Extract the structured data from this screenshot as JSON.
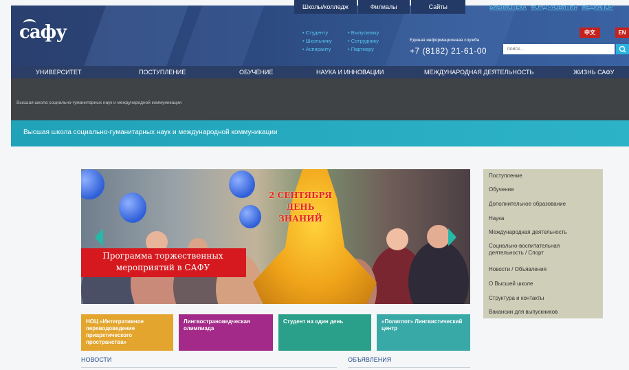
{
  "header": {
    "logo": "сафу",
    "top_tabs": [
      "Школы/колледж",
      "Филиалы",
      "Сайты"
    ],
    "top_links": [
      "БИБЛИОТЕКА",
      "ФОНД РАЗВИТИЯ",
      "МЕДИАПОР"
    ],
    "quick_links": [
      "Студенту",
      "Выпускнику",
      "Школьнику",
      "Сотруднику",
      "Аспиранту",
      "Партнеру"
    ],
    "contact_label": "Единая информационная служба",
    "phone": "+7 (8182) 21-61-00",
    "lang_zh": "中文",
    "lang_en": "EN",
    "search_placeholder": "поиск..."
  },
  "nav": [
    "УНИВЕРСИТЕТ",
    "ПОСТУПЛЕНИЕ",
    "ОБУЧЕНИЕ",
    "НАУКА И ИННОВАЦИИ",
    "МЕЖДУНАРОДНАЯ ДЕЯТЕЛЬНОСТЬ",
    "ЖИЗНЬ САФУ"
  ],
  "breadcrumb": "Высшая школа социально-гуманитарных наук и международной коммуникации",
  "page_title": "Высшая школа социально-гуманитарных наук и международной коммуникации",
  "slider": {
    "bell_text": [
      "2 СЕНТЯБРЯ",
      "ДЕНЬ",
      "ЗНАНИЙ"
    ],
    "promo": "Программа торжественных мероприятий в САФУ"
  },
  "side_menu": [
    "Поступление",
    "Обучение",
    "Дополнительное образование",
    "Наука",
    "Международная деятельность",
    "Социально-воспитательная деятельность / Спорт",
    "Новости / Объявления",
    "О Высшей школе",
    "Структура и контакты",
    "Вакансии для выпускников"
  ],
  "tiles": [
    {
      "label": "НОЦ «Интегративное переводоведение приарктического пространства»",
      "color": "#e3a52e"
    },
    {
      "label": "Лингвострановедческая олимпиада",
      "color": "#a32a88"
    },
    {
      "label": "Студент на один день",
      "color": "#2a9f8a"
    },
    {
      "label": "«Полиглот» Лингвистический центр",
      "color": "#39a9a8"
    }
  ],
  "sections": {
    "news": "НОВОСТИ",
    "announcements": "ОБЪЯВЛЕНИЯ"
  }
}
